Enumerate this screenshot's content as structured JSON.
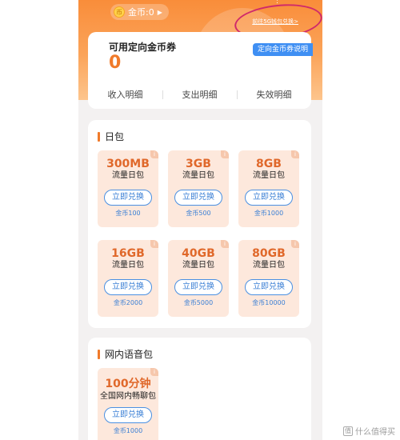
{
  "header": {
    "coin_label": "金币:0",
    "coin_symbol": "币",
    "go_exchange_link": "前往5G钱包兑换>",
    "deco_text": "5G"
  },
  "coupon": {
    "title": "可用定向金币券",
    "count": "0",
    "help_label": "定向金币券说明",
    "tabs": [
      "收入明细",
      "支出明细",
      "失效明细"
    ]
  },
  "day_pack": {
    "title": "日包",
    "items": [
      {
        "size": "300MB",
        "name": "流量日包",
        "button": "立即兑换",
        "cost": "金币100"
      },
      {
        "size": "3GB",
        "name": "流量日包",
        "button": "立即兑换",
        "cost": "金币500"
      },
      {
        "size": "8GB",
        "name": "流量日包",
        "button": "立即兑换",
        "cost": "金币1000"
      },
      {
        "size": "16GB",
        "name": "流量日包",
        "button": "立即兑换",
        "cost": "金币2000"
      },
      {
        "size": "40GB",
        "name": "流量日包",
        "button": "立即兑换",
        "cost": "金币5000"
      },
      {
        "size": "80GB",
        "name": "流量日包",
        "button": "立即兑换",
        "cost": "金币10000"
      }
    ]
  },
  "voice_pack": {
    "title": "网内语音包",
    "items": [
      {
        "size": "100分钟",
        "name": "全国网内畅聊包",
        "button": "立即兑换",
        "cost": "金币1000"
      }
    ]
  },
  "watermark": {
    "text": "什么值得买",
    "icon": "值"
  },
  "colors": {
    "accent": "#f07a2a",
    "link_blue": "#3a7fd5",
    "annotation": "#d02a6a"
  }
}
